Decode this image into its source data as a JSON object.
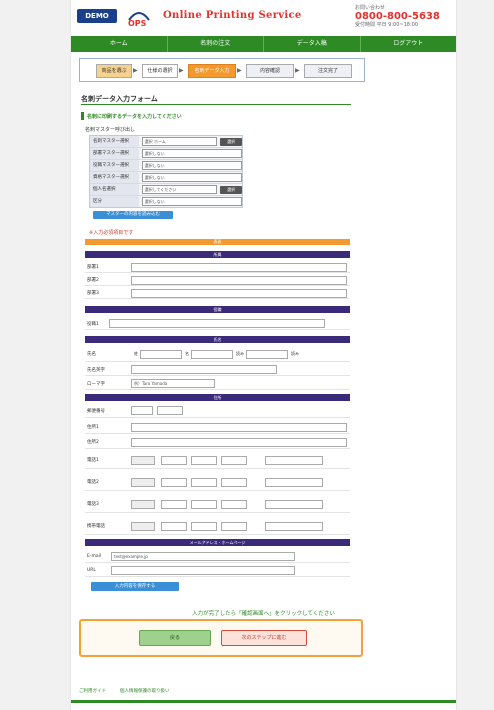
{
  "header": {
    "demo_badge": "DEMO",
    "logo_text": "Online Printing Service",
    "contact_label": "お問い合わせ",
    "phone": "0800-800-5638",
    "contact_sub": "受付時間 平日 9:00~18:00"
  },
  "nav": {
    "items": [
      "ホーム",
      "名刺の注文",
      "データ入稿",
      "ログアウト"
    ]
  },
  "steps": {
    "items": [
      "商品を選ぶ",
      "仕様の選択",
      "名刺データ入力",
      "内容確認",
      "注文完了"
    ]
  },
  "form": {
    "title": "名刺データ入力フォーム",
    "note": "名刺に印刷するデータを入力してください",
    "master_label": "名刺マスター呼び出し",
    "master_rows": [
      {
        "label": "名刺マスター選択",
        "value": "選択 ホーム",
        "btn": "選択"
      },
      {
        "label": "部署マスター選択",
        "value": "選択しない",
        "btn": ""
      },
      {
        "label": "役職マスター選択",
        "value": "選択しない",
        "btn": ""
      },
      {
        "label": "資格マスター選択",
        "value": "選択しない",
        "btn": ""
      },
      {
        "label": "個人名選択",
        "value": "選択してください",
        "btn": "選択"
      },
      {
        "label": "区分",
        "value": "選択しない",
        "btn": ""
      }
    ],
    "load_button": "マスターの内容を読み込む",
    "red_note": "※入力必須項目です",
    "orange_band": "表面",
    "band_labels": [
      "所属",
      "役職",
      "氏名",
      "住所",
      "連絡先"
    ],
    "affiliation_rows": [
      "部署1",
      "部署2",
      "部署3"
    ],
    "title_row": "役職1",
    "name_rows": [
      {
        "label": "氏名",
        "f1": "姓",
        "f2": "名",
        "f3": "読み",
        "f4": "読み"
      },
      {
        "label": "氏名英字",
        "f1": "",
        "f2": "",
        "f3": "",
        "f4": ""
      },
      {
        "label": "ローマ字",
        "f1": "例）Taro Yamada",
        "f2": "",
        "f3": "",
        "f4": ""
      }
    ],
    "address_rows": [
      "郵便番号",
      "住所1",
      "住所2"
    ],
    "contact_rows": [
      "電話1",
      "電話2",
      "電話3",
      "携帯電話"
    ],
    "web_band": "メールアドレス・ホームページ",
    "email_label": "E-mail",
    "email_value": "test@example.jp",
    "url_label": "URL",
    "save_button": "入力内容を保存する",
    "confirm_note": "入力が完了したら「確認画面へ」をクリックしてください",
    "back_button": "戻る",
    "next_button": "次のステップに進む"
  },
  "footer": {
    "links": [
      "ご利用ガイド",
      "個人情報保護の取り扱い"
    ]
  },
  "colors": {
    "primary_green": "#2d8a24",
    "accent_orange": "#f29a2e",
    "header_red": "#e3322b",
    "band_purple": "#3b2a7a",
    "link_blue": "#3a8fd6"
  }
}
